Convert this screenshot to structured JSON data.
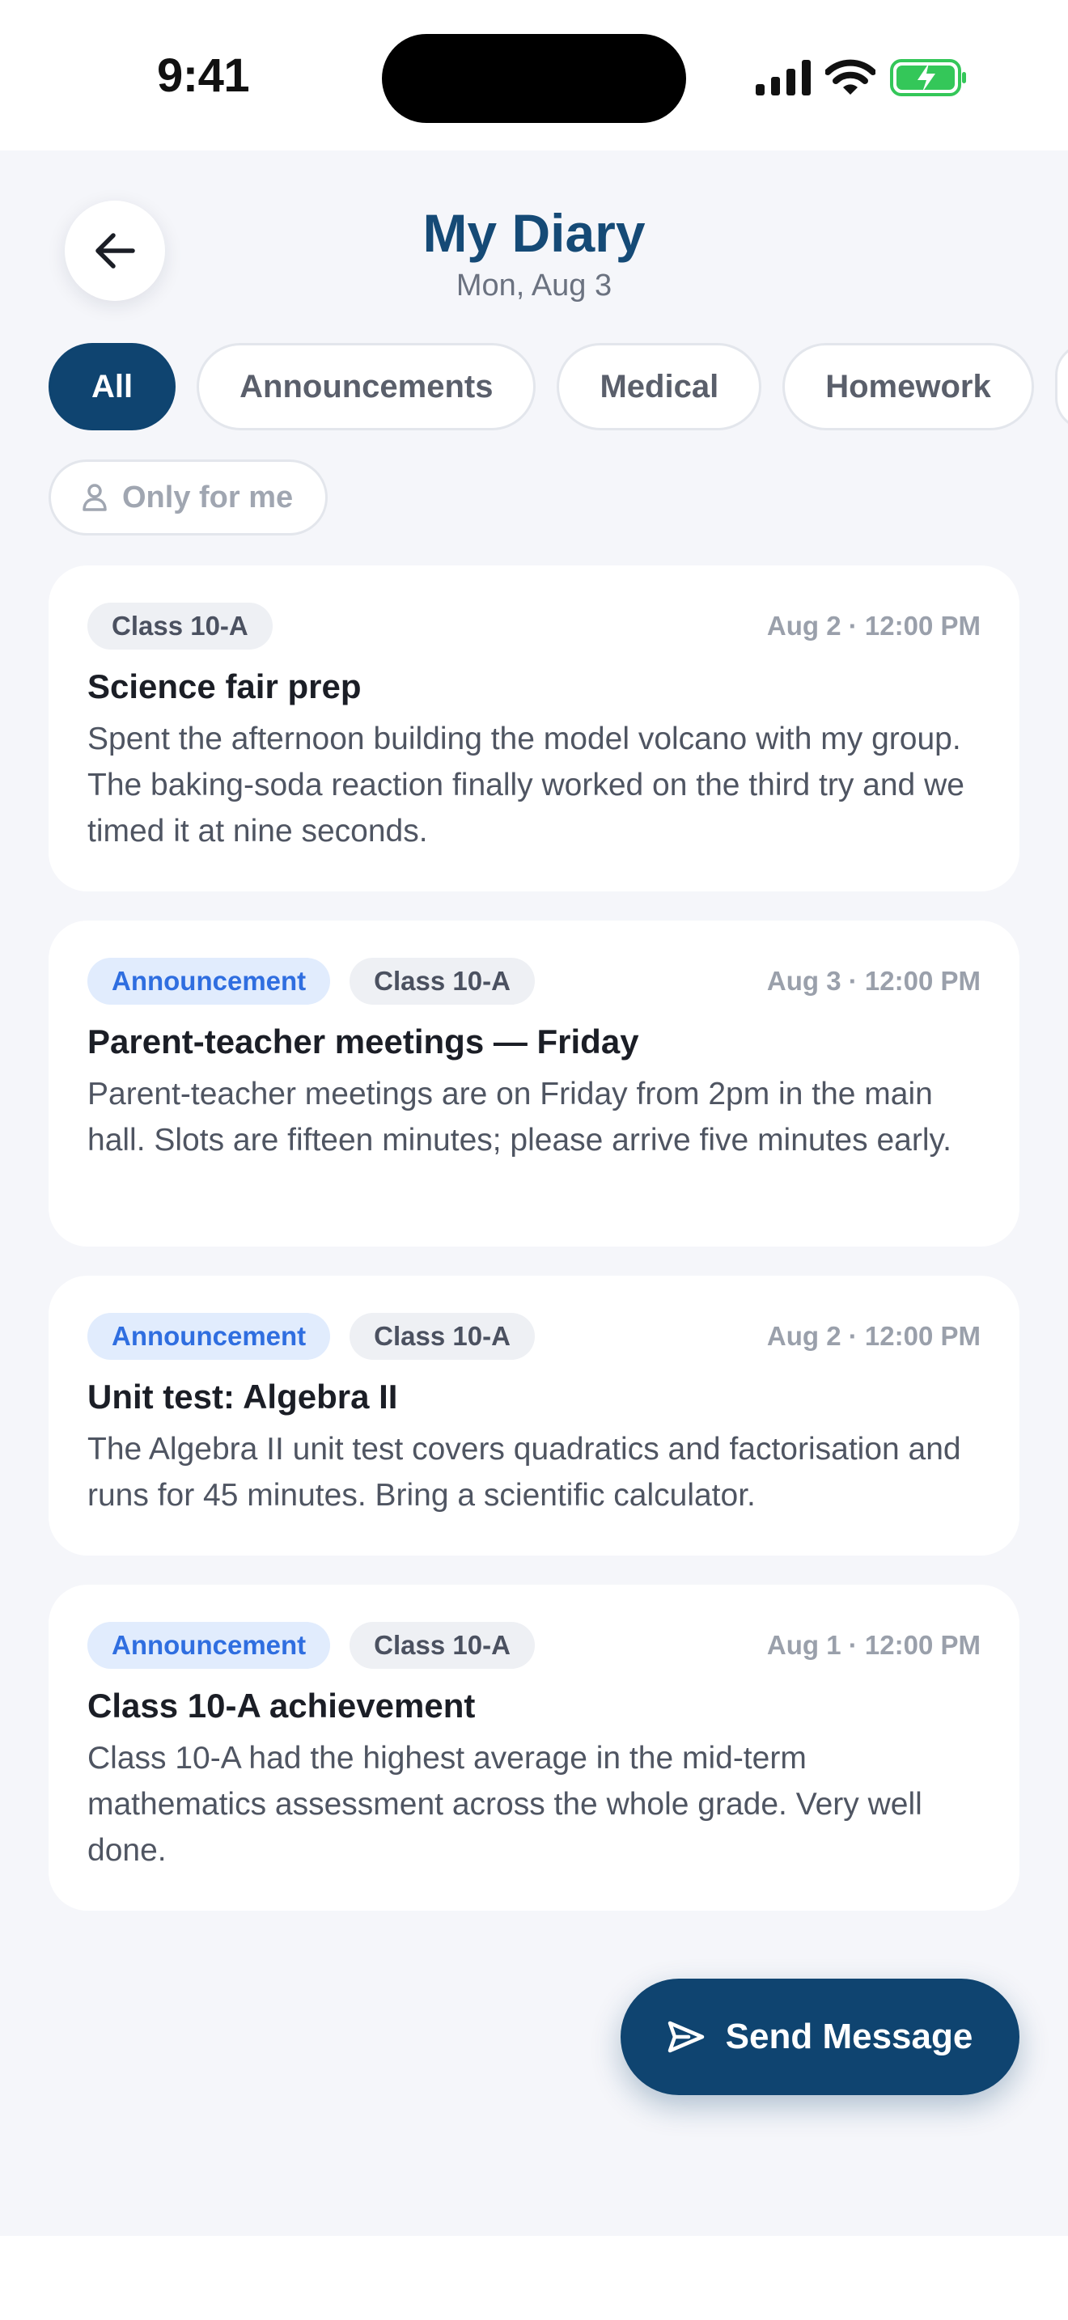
{
  "status_bar": {
    "time": "9:41"
  },
  "header": {
    "title": "My Diary",
    "date": "Mon, Aug 3"
  },
  "filters": {
    "chips": [
      "All",
      "Announcements",
      "Medical",
      "Homework"
    ],
    "active": "All",
    "only_me": "Only for me"
  },
  "entries": [
    {
      "tags": [
        {
          "label": "Class 10-A",
          "kind": "class"
        }
      ],
      "timestamp": "Aug 2 · 12:00 PM",
      "title": "Science fair prep",
      "body": "Spent the afternoon building the model volcano with my group. The baking-soda reaction finally worked on the third try and we timed it at nine seconds."
    },
    {
      "tags": [
        {
          "label": "Announcement",
          "kind": "announce"
        },
        {
          "label": "Class 10-A",
          "kind": "class"
        }
      ],
      "timestamp": "Aug 3 · 12:00 PM",
      "title": "Parent-teacher meetings — Friday",
      "body": "Parent-teacher meetings are on Friday from 2pm in the main hall. Slots are fifteen minutes; please arrive five minutes early."
    },
    {
      "tags": [
        {
          "label": "Announcement",
          "kind": "announce"
        },
        {
          "label": "Class 10-A",
          "kind": "class"
        }
      ],
      "timestamp": "Aug 2 · 12:00 PM",
      "title": "Unit test: Algebra II",
      "body": "The Algebra II unit test covers quadratics and factorisation and runs for 45 minutes. Bring a scientific calculator."
    },
    {
      "tags": [
        {
          "label": "Announcement",
          "kind": "announce"
        },
        {
          "label": "Class 10-A",
          "kind": "class"
        }
      ],
      "timestamp": "Aug 1 · 12:00 PM",
      "title": "Class 10-A achievement",
      "body": "Class 10-A had the highest average in the mid-term mathematics assessment across the whole grade. Very well done."
    }
  ],
  "fab": {
    "label": "Send Message",
    "icon": "send-icon"
  },
  "colors": {
    "primary": "#0f4470",
    "title": "#154a76",
    "background": "#f5f6fa",
    "announcement_tag": "#2f6ee0",
    "battery": "#34c759"
  }
}
